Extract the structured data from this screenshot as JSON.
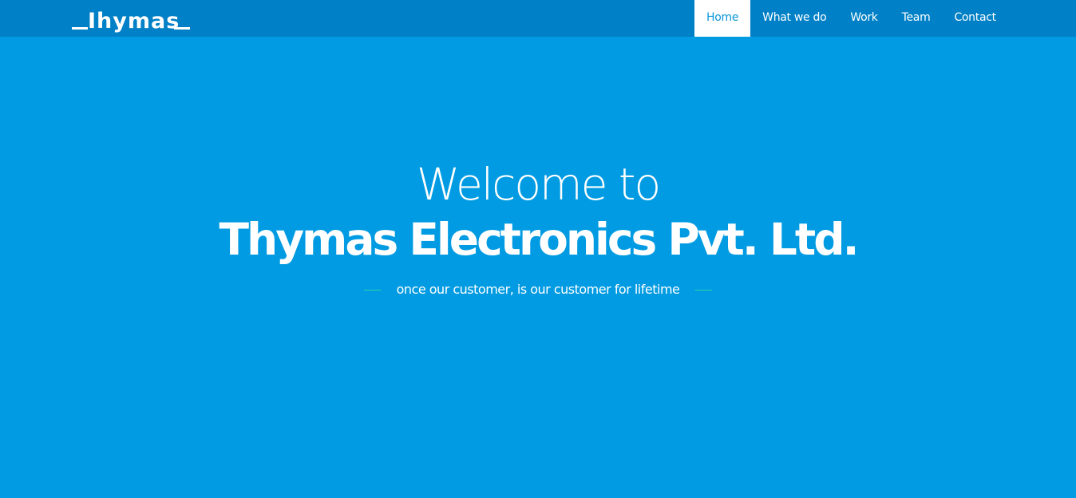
{
  "brand": {
    "logo_text": "Ihymas"
  },
  "nav": {
    "items": [
      {
        "label": "Home",
        "active": true
      },
      {
        "label": "What we do",
        "active": false
      },
      {
        "label": "Work",
        "active": false
      },
      {
        "label": "Team",
        "active": false
      },
      {
        "label": "Contact",
        "active": false
      }
    ]
  },
  "hero": {
    "line1": "Welcome to",
    "line2": "Thymas Electronics Pvt. Ltd.",
    "tagline": "once our customer, is our customer for lifetime"
  },
  "colors": {
    "background": "#009be2",
    "navbar": "#0080c6",
    "active_nav_text": "#0a97d9",
    "accent_dash": "#2ad6a8"
  }
}
